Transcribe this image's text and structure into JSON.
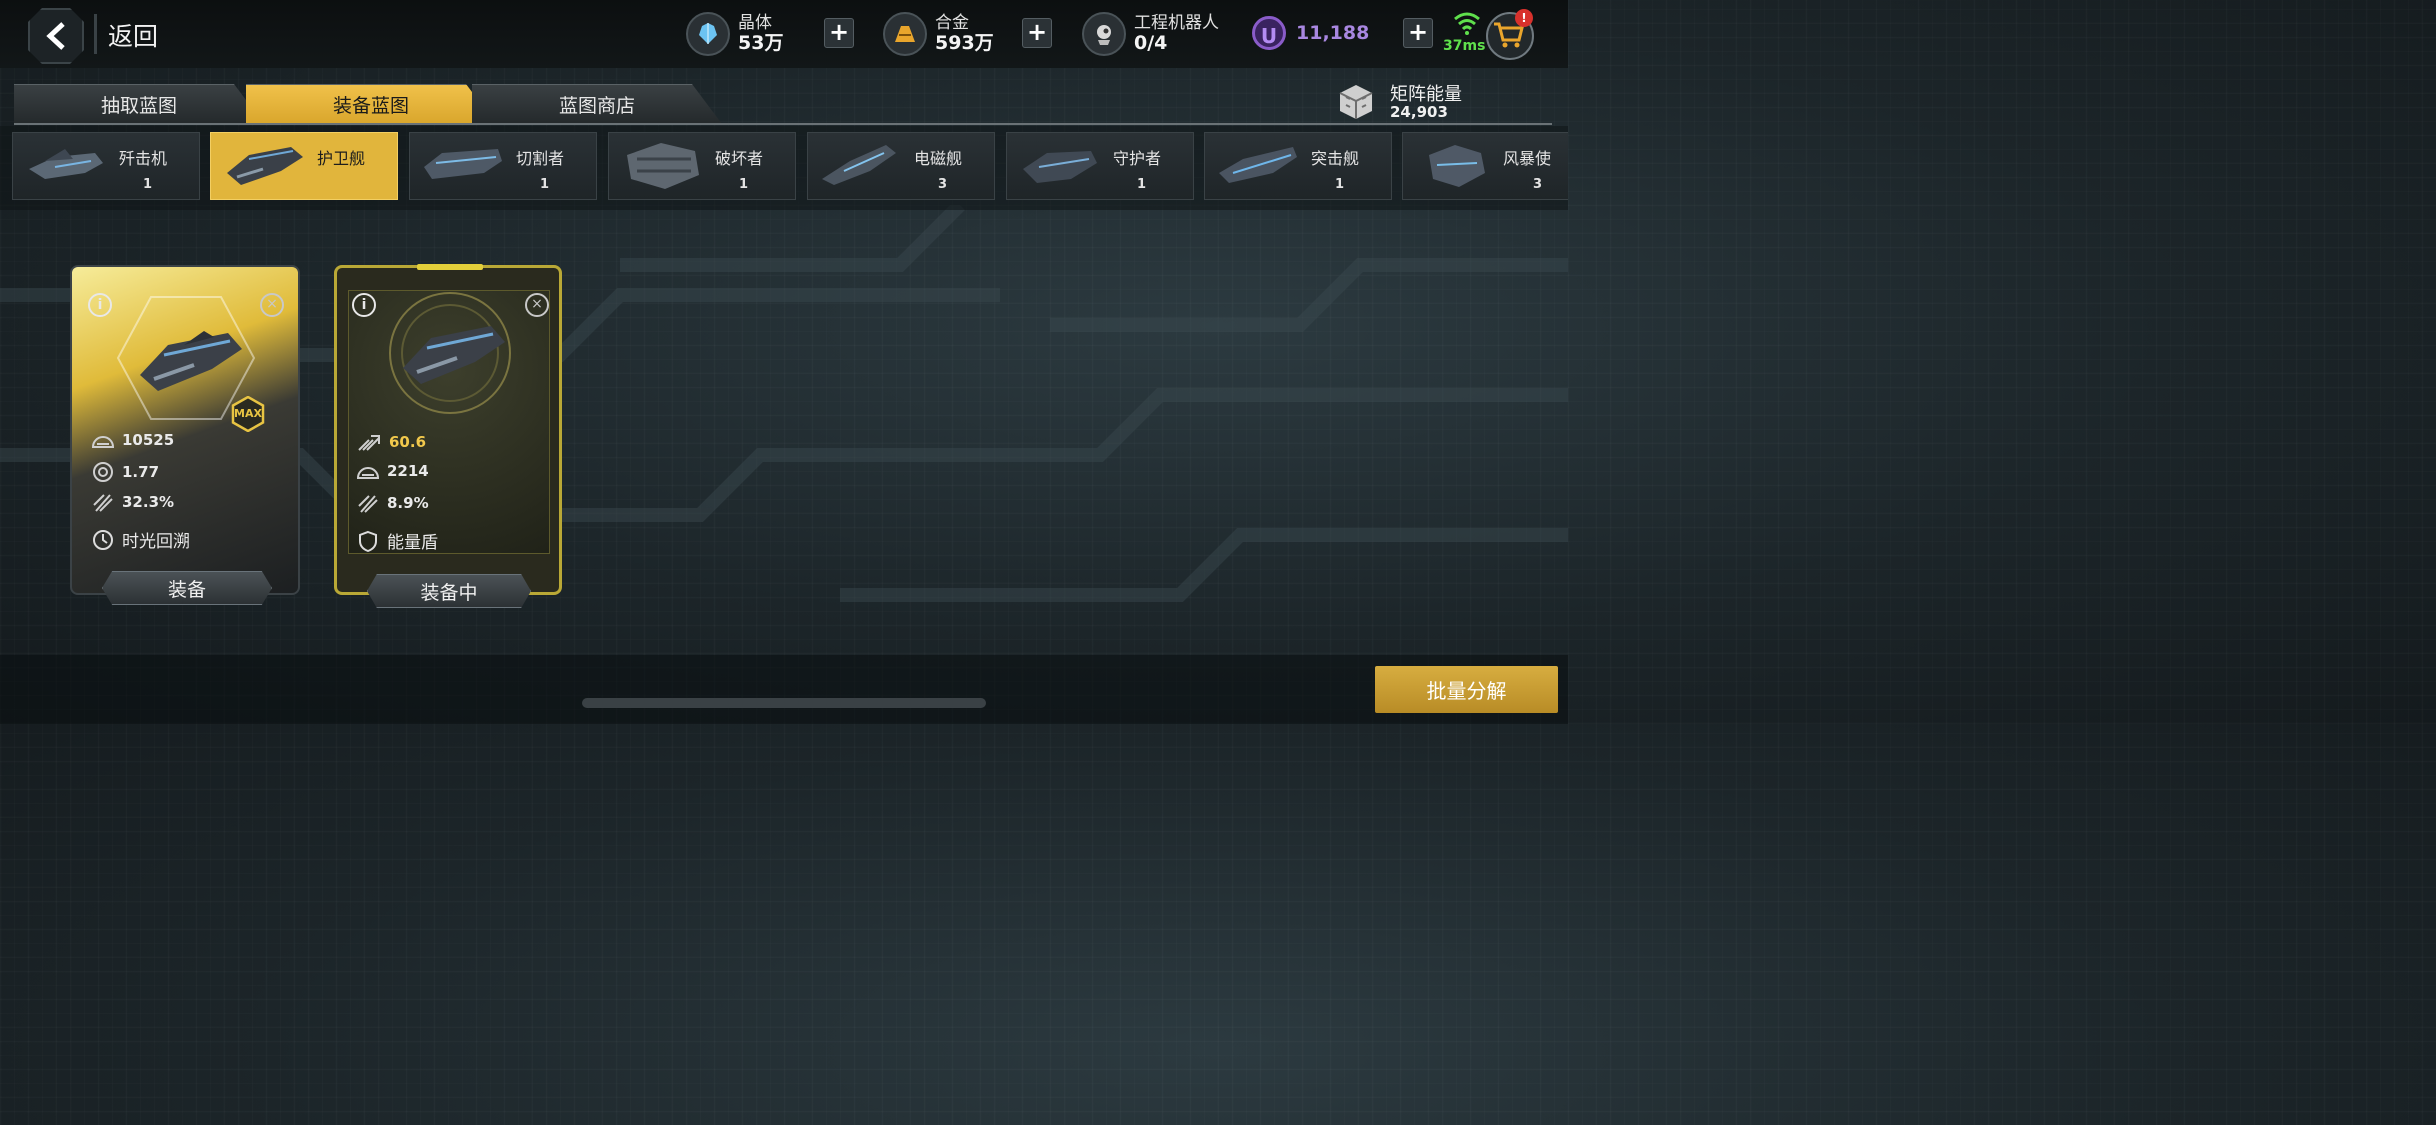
{
  "header": {
    "back_label": "返回",
    "resources": [
      {
        "label": "晶体",
        "value": "53万",
        "icon": "crystal-icon"
      },
      {
        "label": "合金",
        "value": "593万",
        "icon": "alloy-icon"
      },
      {
        "label": "工程机器人",
        "value": "0/4",
        "icon": "robot-icon"
      }
    ],
    "currency": {
      "symbol": "U",
      "value": "11,188"
    },
    "ping": "37ms",
    "cart_badge": "!"
  },
  "tabs": [
    {
      "label": "抽取蓝图",
      "active": false
    },
    {
      "label": "装备蓝图",
      "active": true
    },
    {
      "label": "蓝图商店",
      "active": false
    }
  ],
  "matrix_energy": {
    "label": "矩阵能量",
    "value": "24,903"
  },
  "ship_types": [
    {
      "name": "歼击机",
      "count": "1",
      "active": false
    },
    {
      "name": "护卫舰",
      "count": "",
      "active": true
    },
    {
      "name": "切割者",
      "count": "1",
      "active": false
    },
    {
      "name": "破坏者",
      "count": "1",
      "active": false
    },
    {
      "name": "电磁舰",
      "count": "3",
      "active": false
    },
    {
      "name": "守护者",
      "count": "1",
      "active": false
    },
    {
      "name": "突击舰",
      "count": "1",
      "active": false
    },
    {
      "name": "风暴使",
      "count": "3",
      "active": false
    }
  ],
  "cards": [
    {
      "badge": "MAX",
      "stats": [
        {
          "icon": "hull-icon",
          "value": "10525"
        },
        {
          "icon": "speed-icon",
          "value": "1.77"
        },
        {
          "icon": "crit-icon",
          "value": "32.3%"
        }
      ],
      "skill": {
        "icon": "time-rewind-icon",
        "name": "时光回溯"
      },
      "button": "装备"
    },
    {
      "stats": [
        {
          "icon": "firepower-icon",
          "value": "60.6"
        },
        {
          "icon": "hull-icon",
          "value": "2214"
        },
        {
          "icon": "crit-icon",
          "value": "8.9%"
        }
      ],
      "skill": {
        "icon": "shield-icon",
        "name": "能量盾"
      },
      "button": "装备中"
    }
  ],
  "batch_button": "批量分解",
  "colors": {
    "accent": "#e1b53c",
    "currency": "#a887e0",
    "ping": "#5fe04c"
  }
}
